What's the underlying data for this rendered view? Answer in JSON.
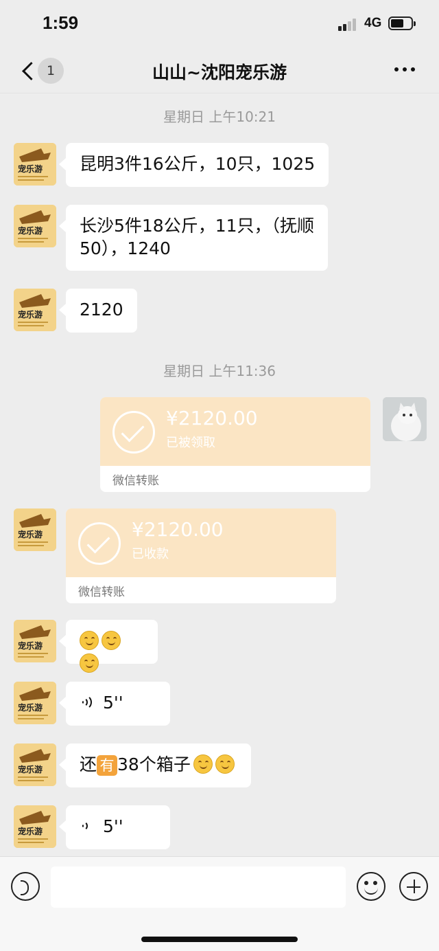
{
  "status_bar": {
    "time": "1:59",
    "network": "4G"
  },
  "nav": {
    "unread_count": "1",
    "title": "山山~沈阳宠乐游"
  },
  "timestamps": [
    "星期日 上午10:21",
    "星期日 上午11:36"
  ],
  "messages": {
    "m1": "昆明3件16公斤，10只，1025",
    "m2_line1": "长沙5件18公斤，11只，（抚顺",
    "m2_line2": "50），1240",
    "m3": "2120",
    "m7_a": "还",
    "m7_you": "有",
    "m7_b": "38个箱子"
  },
  "transfers": [
    {
      "amount": "¥2120.00",
      "status": "已被领取",
      "label": "微信转账"
    },
    {
      "amount": "¥2120.00",
      "status": "已收款",
      "label": "微信转账"
    }
  ],
  "voice_messages": [
    {
      "duration": "5''"
    },
    {
      "duration": "5''"
    }
  ],
  "avatar": {
    "logo_text": "宠乐游"
  },
  "input": {
    "placeholder": ""
  },
  "icons": {
    "back": "chevron-left-icon",
    "more": "more-dots-icon",
    "voice": "voice-icon",
    "emoji": "emoji-icon",
    "plus": "plus-icon",
    "check": "check-icon"
  },
  "colors": {
    "background": "#ededed",
    "bubble": "#ffffff",
    "transfer": "#fbe5c4"
  }
}
